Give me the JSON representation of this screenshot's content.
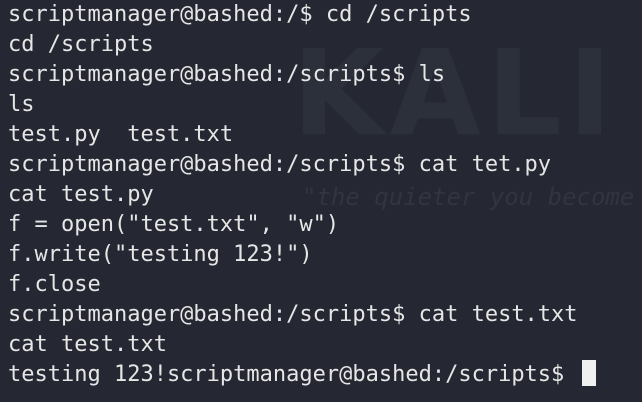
{
  "watermark": {
    "logo": "KALI",
    "tagline": "\"the quieter you become"
  },
  "terminal": {
    "lines": [
      "scriptmanager@bashed:/$ cd /scripts",
      "cd /scripts",
      "scriptmanager@bashed:/scripts$ ls",
      "ls",
      "test.py  test.txt",
      "scriptmanager@bashed:/scripts$ cat tet.py",
      "cat test.py",
      "f = open(\"test.txt\", \"w\")",
      "f.write(\"testing 123!\")",
      "f.close",
      "scriptmanager@bashed:/scripts$ cat test.txt",
      "cat test.txt",
      "testing 123!scriptmanager@bashed:/scripts$ "
    ]
  },
  "colors": {
    "background": "#252832",
    "text": "#e6e6e6",
    "cursor": "#f0f0f0"
  }
}
